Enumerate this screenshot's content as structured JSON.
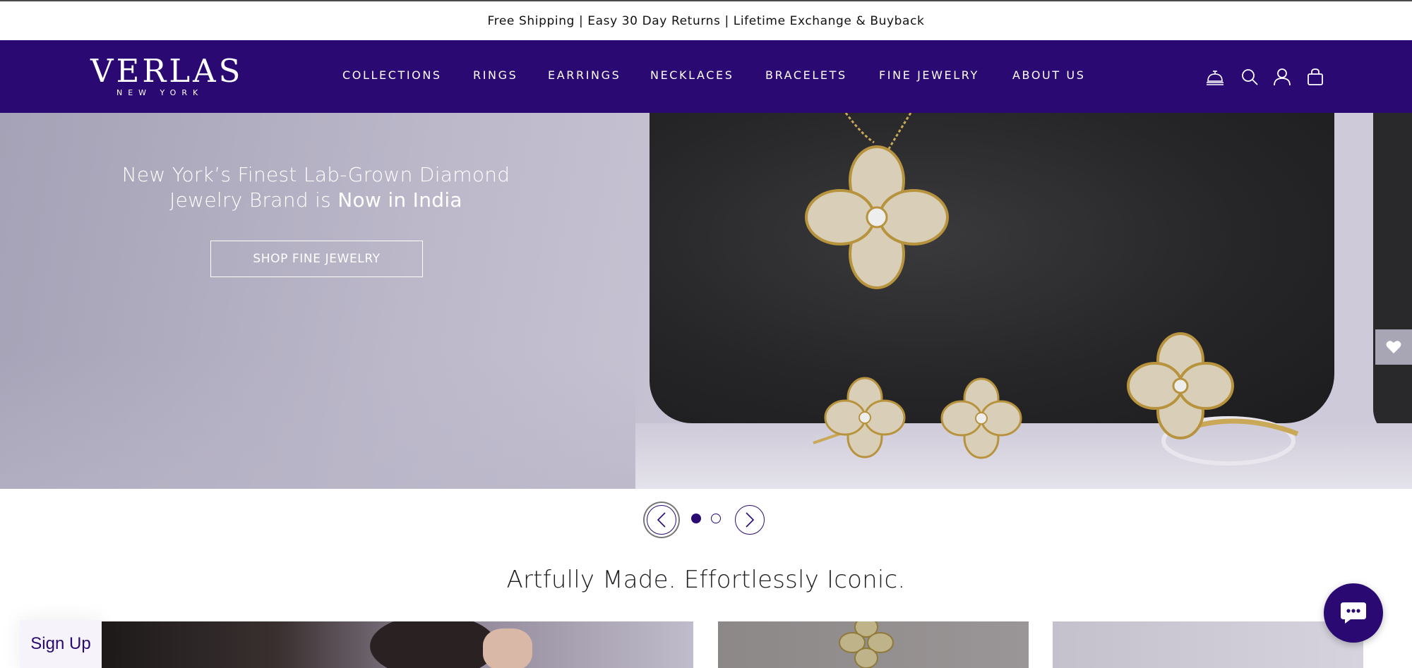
{
  "announcement": {
    "text": "Free Shipping | Easy 30 Day Returns | Lifetime Exchange & Buyback"
  },
  "brand": {
    "wordmark": "VERLAS",
    "subtitle": "NEW YORK"
  },
  "nav": {
    "items": [
      {
        "label": "COLLECTIONS"
      },
      {
        "label": "RINGS"
      },
      {
        "label": "EARRINGS"
      },
      {
        "label": "NECKLACES"
      },
      {
        "label": "BRACELETS"
      },
      {
        "label": "FINE JEWELRY"
      },
      {
        "label": "ABOUT US"
      }
    ]
  },
  "header_icons": [
    "concierge-bell-icon",
    "search-icon",
    "account-icon",
    "shopping-bag-icon"
  ],
  "hero": {
    "headline_line1": "New York’s Finest Lab-Grown Diamond",
    "headline_line2_light": "Jewelry Brand is ",
    "headline_line2_strong": "Now in India",
    "cta_label": "SHOP FINE JEWELRY"
  },
  "carousel": {
    "slide_count": 2,
    "active_slide": 1
  },
  "section": {
    "title": "Artfully Made. Effortlessly Iconic."
  },
  "signup": {
    "label": "Sign Up"
  },
  "colors": {
    "brand_purple": "#2a0a72",
    "announcement_bg": "#ffffff",
    "hero_block": "#262628",
    "wishlist_tab": "#a8a6b4"
  }
}
